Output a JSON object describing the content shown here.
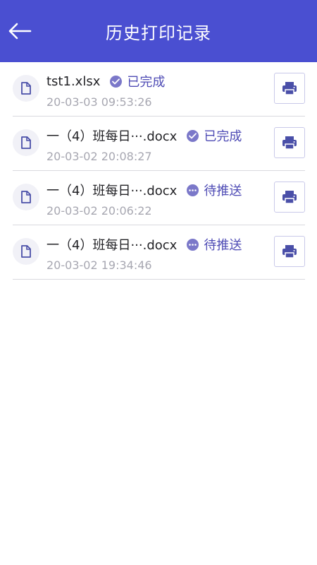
{
  "header": {
    "title": "历史打印记录",
    "back_icon": "arrow-left-icon"
  },
  "colors": {
    "accent": "#4a4fd1",
    "status": "#4f4cb5"
  },
  "records": [
    {
      "file_name": "tst1.xlsx",
      "status": "已完成",
      "status_icon": "check-circle-icon",
      "time": "20-03-03 09:53:26"
    },
    {
      "file_name": "一（4）班每日···.docx",
      "status": "已完成",
      "status_icon": "check-circle-icon",
      "time": "20-03-02 20:08:27"
    },
    {
      "file_name": "一（4）班每日···.docx",
      "status": "待推送",
      "status_icon": "more-circle-icon",
      "time": "20-03-02 20:06:22"
    },
    {
      "file_name": "一（4）班每日···.docx",
      "status": "待推送",
      "status_icon": "more-circle-icon",
      "time": "20-03-02 19:34:46"
    }
  ]
}
